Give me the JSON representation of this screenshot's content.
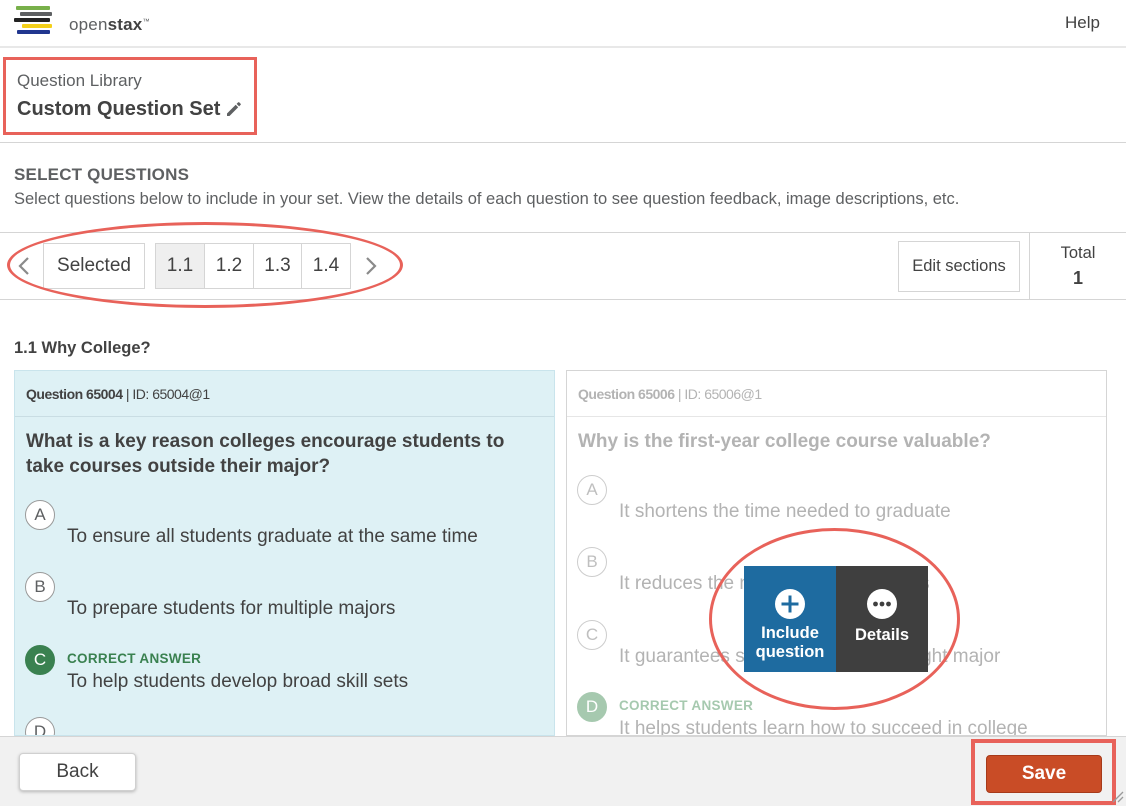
{
  "header": {
    "logo_text_light": "open",
    "logo_text_bold": "stax",
    "logo_tm": "™",
    "help_label": "Help",
    "logo_colors": [
      "#78b04a",
      "#232323",
      "#f4d019",
      "#21368f",
      "#5e6062"
    ]
  },
  "title_block": {
    "library_label": "Question Library",
    "set_name": "Custom Question Set",
    "edit_icon": "pencil-icon"
  },
  "select_section": {
    "title": "SELECT QUESTIONS",
    "description": "Select questions below to include in your set. View the details of each question to see question feedback, image descriptions, etc."
  },
  "nav": {
    "prev_icon": "chevron-left-icon",
    "next_icon": "chevron-right-icon",
    "selected_label": "Selected",
    "sections": [
      "1.1",
      "1.2",
      "1.3",
      "1.4"
    ],
    "active_section": "1.1",
    "edit_sections_label": "Edit sections",
    "total_label": "Total",
    "total_value": "1"
  },
  "section_heading": "1.1 Why College?",
  "questions": [
    {
      "number_label": "Question 65004",
      "id_label": "ID: 65004@1",
      "stem": "What is a key reason colleges encourage students to take courses outside their major?",
      "options": [
        {
          "letter": "A",
          "text": "To ensure all students graduate at the same time"
        },
        {
          "letter": "B",
          "text": "To prepare students for multiple majors"
        },
        {
          "letter": "C",
          "text": "To help students develop broad skill sets",
          "correct_label": "CORRECT ANSWER"
        },
        {
          "letter": "D",
          "text": ""
        }
      ]
    },
    {
      "number_label": "Question 65006",
      "id_label": "ID: 65006@1",
      "stem": "Why is the first-year college course valuable?",
      "options": [
        {
          "letter": "A",
          "text": "It shortens the time needed to graduate"
        },
        {
          "letter": "B",
          "text": "It reduces the need for other courses"
        },
        {
          "letter": "C",
          "text": "It guarantees students choose the right major"
        },
        {
          "letter": "D",
          "text": "It helps students learn how to succeed in college",
          "correct_label": "CORRECT ANSWER"
        }
      ]
    }
  ],
  "overlay": {
    "include_line1": "Include",
    "include_line2": "question",
    "include_icon": "plus-circle-icon",
    "details_label": "Details",
    "details_icon": "ellipsis-circle-icon"
  },
  "footer": {
    "back_label": "Back",
    "save_label": "Save"
  },
  "colors": {
    "highlight": "#e8625a",
    "include_bg": "#1e6ba0",
    "details_bg": "#3f3f3f",
    "save_bg": "#c94c26",
    "correct_green": "#3a8150",
    "selected_card_bg": "#def1f5"
  }
}
